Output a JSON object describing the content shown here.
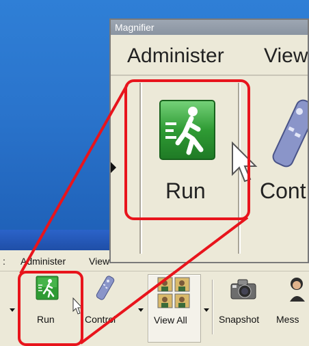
{
  "magnifier": {
    "title": "Magnifier",
    "menu": [
      "Administer",
      "View"
    ],
    "buttons": [
      {
        "label": "Run",
        "icon": "run-icon"
      },
      {
        "label": "Cont",
        "icon": "remote-control-icon"
      }
    ]
  },
  "app": {
    "menu": [
      "Administer",
      "View"
    ],
    "toolbar": [
      {
        "label": "Run",
        "icon": "run-icon"
      },
      {
        "label": "Control",
        "icon": "remote-control-icon"
      },
      {
        "label": "View All",
        "icon": "view-all-icon"
      },
      {
        "label": "Snapshot",
        "icon": "camera-icon"
      },
      {
        "label": "Mess",
        "icon": "message-icon"
      }
    ]
  },
  "colors": {
    "desktop": "#2a74cc",
    "callout": "#e8141c",
    "run_green": "#3aa83a"
  }
}
